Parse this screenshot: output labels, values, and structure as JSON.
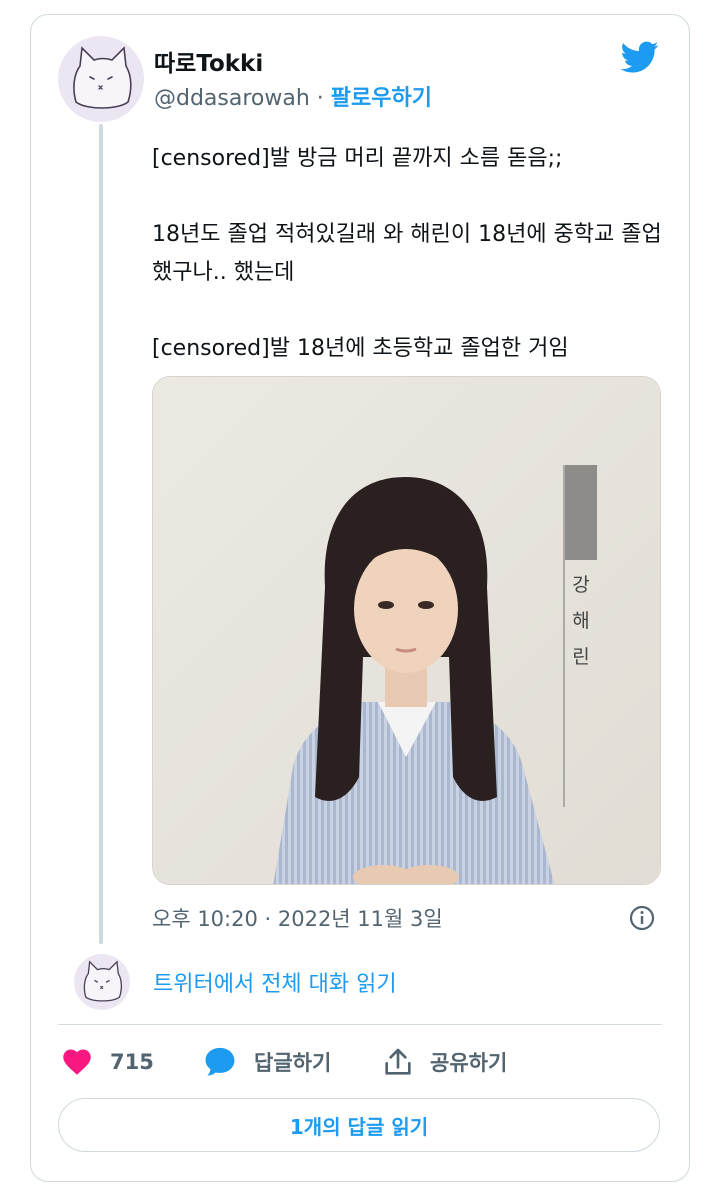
{
  "tweet": {
    "author_name": "따로Tokki",
    "author_handle": "@ddasarowah",
    "separator": "·",
    "follow_label": "팔로우하기",
    "text": "[censored]발 방금 머리 끝까지 소름 돋음;;\n\n18년도 졸업 적혀있길래 와 해린이 18년에 중학교 졸업했구나.. 했는데\n\n[censored]발 18년에 초등학교 졸업한 거임",
    "photo_name_label": "강 해 린",
    "timestamp": "오후 10:20 · 2022년 11월 3일"
  },
  "thread": {
    "read_conversation": "트위터에서 전체 대화 읽기"
  },
  "actions": {
    "like_count": "715",
    "reply_label": "답글하기",
    "share_label": "공유하기"
  },
  "footer": {
    "read_replies": "1개의 답글 읽기"
  },
  "colors": {
    "accent": "#1d9bf0",
    "like": "#f91880",
    "text_secondary": "#536471",
    "border": "#cfd9de"
  },
  "icons": [
    "twitter-bird-icon",
    "info-icon",
    "heart-icon",
    "reply-bubble-icon",
    "share-icon"
  ]
}
